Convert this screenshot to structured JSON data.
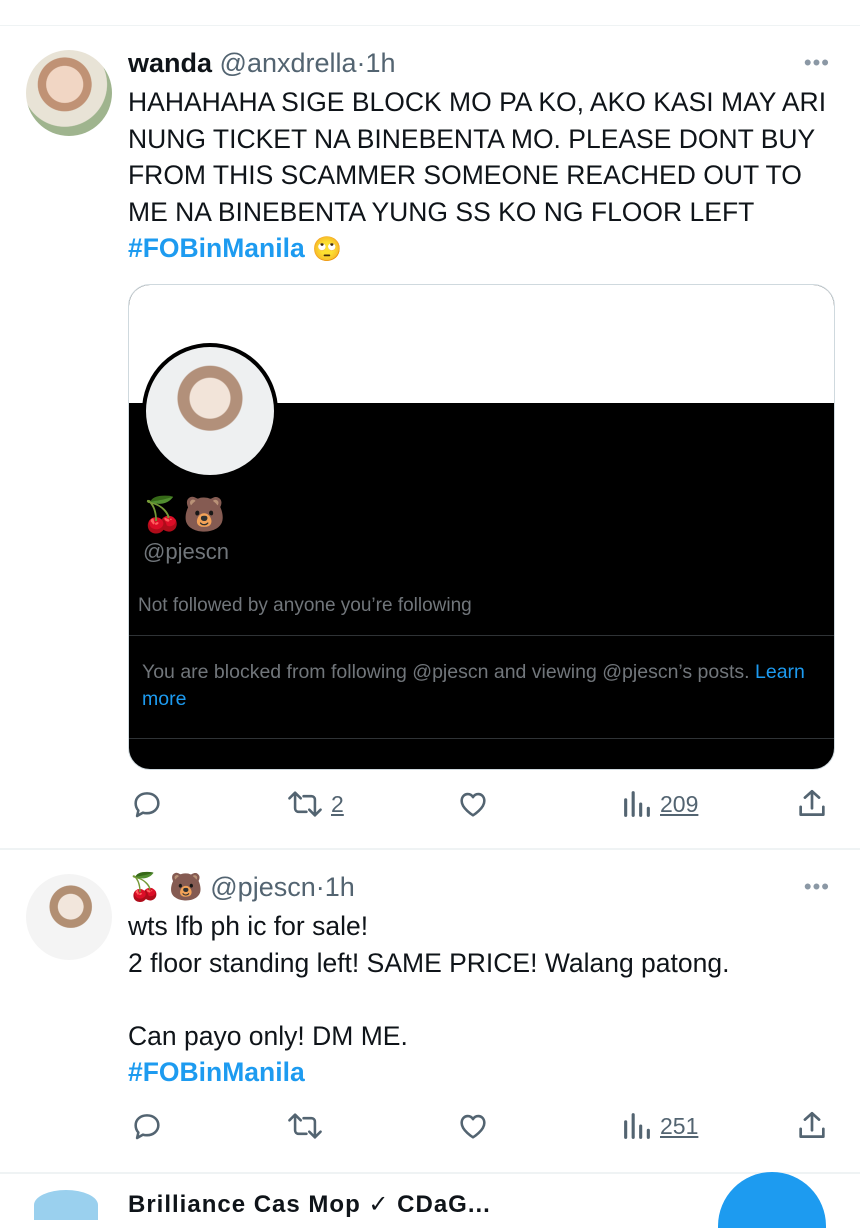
{
  "tweets": [
    {
      "display_name": "wanda",
      "handle": "@anxdrella",
      "separator": "·",
      "time": "1h",
      "more": "•••",
      "text": "HAHAHAHA SIGE BLOCK MO PA KO, AKO KASI MAY ARI NUNG TICKET NA BINEBENTA MO. PLEASE DONT BUY FROM THIS SCAMMER SOMEONE REACHED OUT TO ME NA BINEBENTA YUNG SS KO NG FLOOR LEFT ",
      "hashtag": "#FOBinManila",
      "emoji": "🙄",
      "quoted_card": {
        "emoji": "🍒🐻",
        "handle": "@pjescn",
        "not_followed": "Not followed by anyone you’re following",
        "blocked_text": "You are blocked from following @pjescn and viewing @pjescn’s posts. ",
        "learn_more": "Learn more"
      },
      "counts": {
        "retweets": "2",
        "views": "209"
      }
    },
    {
      "display_name": "🍒 🐻",
      "handle": "@pjescn",
      "separator": "·",
      "time": "1h",
      "more": "•••",
      "text": "wts lfb ph ic for sale!\n2 floor standing left! SAME PRICE! Walang patong.\n\nCan payo only! DM ME.",
      "hashtag": "#FOBinManila",
      "counts": {
        "views": "251"
      }
    }
  ],
  "next_tweet": {
    "partial_name": "Brilliance Cas Mop  ✓  CDaG..."
  },
  "icons": [
    "reply-icon",
    "retweet-icon",
    "like-icon",
    "views-icon",
    "share-icon"
  ],
  "colors": {
    "accent": "#1d9bf0",
    "secondary_text": "#536471",
    "card_bg": "#000000"
  }
}
